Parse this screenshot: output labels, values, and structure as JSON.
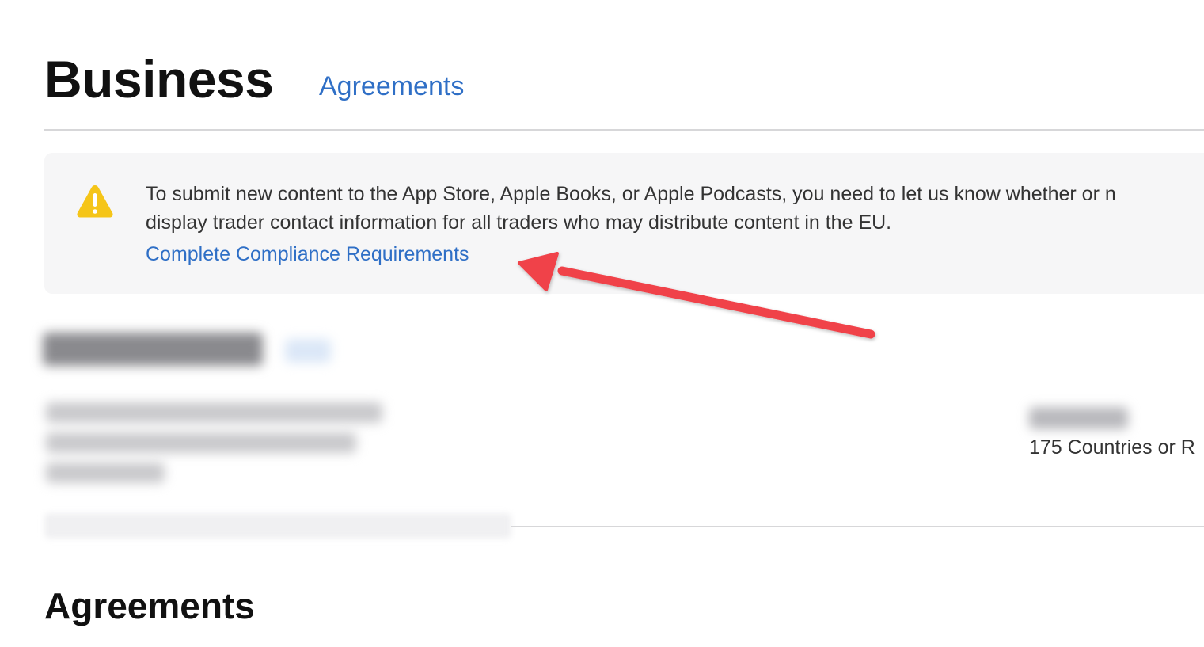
{
  "header": {
    "title": "Business",
    "tab_label": "Agreements"
  },
  "notice": {
    "icon": "warning-icon",
    "line1": "To submit new content to the App Store, Apple Books, or Apple Podcasts, you need to let us know whether or n",
    "line2": "display trader contact information for all traders who may distribute content in the EU.",
    "link_label": "Complete Compliance Requirements"
  },
  "account": {
    "availability": "175 Countries or R"
  },
  "sections": {
    "agreements_title": "Agreements"
  },
  "colors": {
    "link": "#2f6fc6",
    "warning": "#f5c518",
    "annotation_arrow": "#f0424a",
    "notice_background": "#f6f6f7"
  }
}
